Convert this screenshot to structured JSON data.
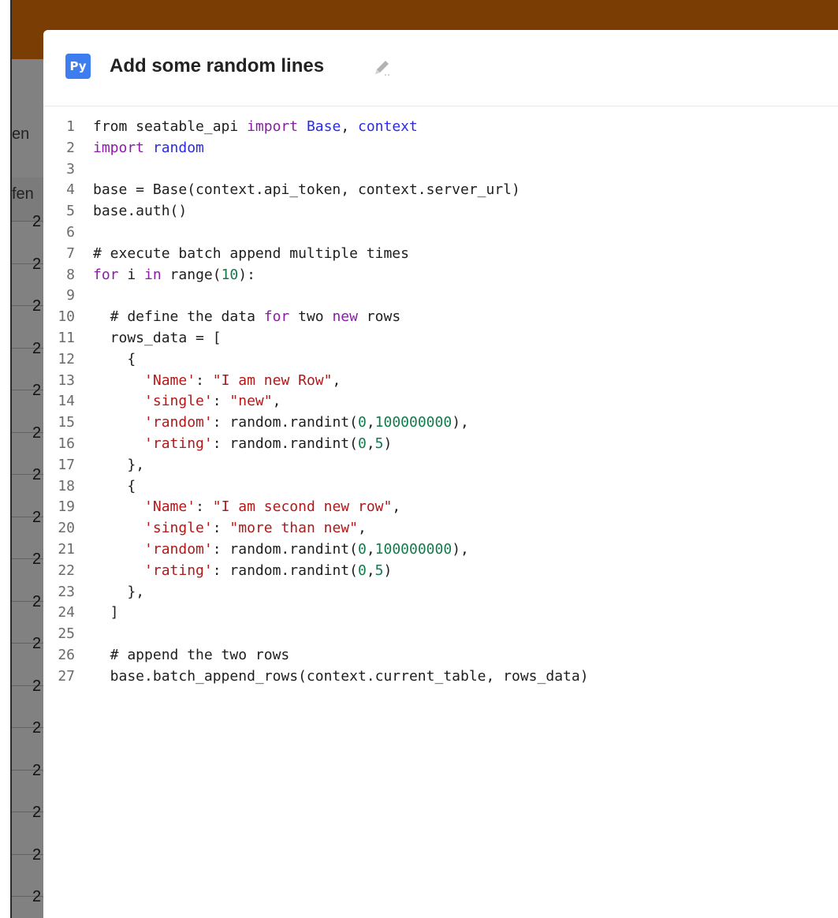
{
  "background": {
    "left_column_texts": [
      "en",
      "fen"
    ],
    "row_numbers": [
      "2",
      "2",
      "2",
      "2",
      "2",
      "2",
      "2",
      "2",
      "2",
      "2",
      "2",
      "2",
      "2",
      "2",
      "2",
      "2",
      "2"
    ]
  },
  "dialog": {
    "badge_label": "Py",
    "title": "Add some random lines",
    "edit_icon": "pencil-icon"
  },
  "code": {
    "lines": [
      {
        "n": "1",
        "tokens": [
          {
            "t": "from seatable_api ",
            "k": "plain"
          },
          {
            "t": "import",
            "k": "keyword"
          },
          {
            "t": " ",
            "k": "plain"
          },
          {
            "t": "Base",
            "k": "builtin"
          },
          {
            "t": ", ",
            "k": "plain"
          },
          {
            "t": "context",
            "k": "builtin"
          }
        ]
      },
      {
        "n": "2",
        "tokens": [
          {
            "t": "import",
            "k": "keyword"
          },
          {
            "t": " ",
            "k": "plain"
          },
          {
            "t": "random",
            "k": "builtin"
          }
        ]
      },
      {
        "n": "3",
        "tokens": []
      },
      {
        "n": "4",
        "tokens": [
          {
            "t": "base = Base(context.api_token, context.server_url)",
            "k": "plain"
          }
        ]
      },
      {
        "n": "5",
        "tokens": [
          {
            "t": "base.auth()",
            "k": "plain"
          }
        ]
      },
      {
        "n": "6",
        "tokens": []
      },
      {
        "n": "7",
        "tokens": [
          {
            "t": "# execute batch append multiple times",
            "k": "comment"
          }
        ]
      },
      {
        "n": "8",
        "tokens": [
          {
            "t": "for",
            "k": "keyword"
          },
          {
            "t": " i ",
            "k": "plain"
          },
          {
            "t": "in",
            "k": "keyword"
          },
          {
            "t": " range",
            "k": "plain"
          },
          {
            "t": "(",
            "k": "plain",
            "mark": true
          },
          {
            "t": "10",
            "k": "number"
          },
          {
            "t": "):",
            "k": "plain"
          }
        ]
      },
      {
        "n": "9",
        "tokens": []
      },
      {
        "n": "10",
        "tokens": [
          {
            "t": "  # define the data ",
            "k": "comment"
          },
          {
            "t": "for",
            "k": "keyword"
          },
          {
            "t": " two ",
            "k": "comment"
          },
          {
            "t": "new",
            "k": "keyword"
          },
          {
            "t": " rows",
            "k": "comment"
          }
        ]
      },
      {
        "n": "11",
        "tokens": [
          {
            "t": "  rows_data = [",
            "k": "plain"
          }
        ]
      },
      {
        "n": "12",
        "tokens": [
          {
            "t": "    {",
            "k": "plain"
          }
        ]
      },
      {
        "n": "13",
        "tokens": [
          {
            "t": "      ",
            "k": "plain"
          },
          {
            "t": "'Name'",
            "k": "string"
          },
          {
            "t": ": ",
            "k": "plain"
          },
          {
            "t": "\"",
            "k": "string",
            "mark": true
          },
          {
            "t": "I am new Row",
            "k": "string"
          },
          {
            "t": "\"",
            "k": "string",
            "mark": true
          },
          {
            "t": ",",
            "k": "plain"
          }
        ]
      },
      {
        "n": "14",
        "tokens": [
          {
            "t": "      ",
            "k": "plain"
          },
          {
            "t": "'single'",
            "k": "string"
          },
          {
            "t": ": ",
            "k": "plain"
          },
          {
            "t": "\"new\"",
            "k": "string",
            "mark": true
          },
          {
            "t": ",",
            "k": "plain"
          }
        ]
      },
      {
        "n": "15",
        "tokens": [
          {
            "t": "      ",
            "k": "plain"
          },
          {
            "t": "'random'",
            "k": "string"
          },
          {
            "t": ": random.randint(",
            "k": "plain"
          },
          {
            "t": "0",
            "k": "number"
          },
          {
            "t": ",",
            "k": "plain"
          },
          {
            "t": "100000000",
            "k": "number"
          },
          {
            "t": "),",
            "k": "plain"
          }
        ]
      },
      {
        "n": "16",
        "tokens": [
          {
            "t": "      ",
            "k": "plain"
          },
          {
            "t": "'rating'",
            "k": "string"
          },
          {
            "t": ": random.randint(",
            "k": "plain"
          },
          {
            "t": "0",
            "k": "number"
          },
          {
            "t": ",",
            "k": "plain"
          },
          {
            "t": "5",
            "k": "number"
          },
          {
            "t": ")",
            "k": "plain"
          }
        ]
      },
      {
        "n": "17",
        "tokens": [
          {
            "t": "   ",
            "k": "plain"
          },
          {
            "t": " }",
            "k": "plain",
            "mark": true
          },
          {
            "t": ",",
            "k": "plain"
          }
        ]
      },
      {
        "n": "18",
        "tokens": [
          {
            "t": "    {",
            "k": "plain"
          }
        ]
      },
      {
        "n": "19",
        "tokens": [
          {
            "t": "      ",
            "k": "plain"
          },
          {
            "t": "'Name'",
            "k": "string"
          },
          {
            "t": ": ",
            "k": "plain"
          },
          {
            "t": "\"",
            "k": "string",
            "mark": true
          },
          {
            "t": "I am second new row",
            "k": "string"
          },
          {
            "t": "\"",
            "k": "string",
            "mark": true
          },
          {
            "t": ",",
            "k": "plain"
          }
        ]
      },
      {
        "n": "20",
        "tokens": [
          {
            "t": "      ",
            "k": "plain"
          },
          {
            "t": "'single'",
            "k": "string"
          },
          {
            "t": ": ",
            "k": "plain"
          },
          {
            "t": "\"",
            "k": "string",
            "mark": true
          },
          {
            "t": "more than new",
            "k": "string"
          },
          {
            "t": "\"",
            "k": "string",
            "mark": true
          },
          {
            "t": ",",
            "k": "plain"
          }
        ]
      },
      {
        "n": "21",
        "tokens": [
          {
            "t": "      ",
            "k": "plain"
          },
          {
            "t": "'random'",
            "k": "string"
          },
          {
            "t": ": random.randint(",
            "k": "plain"
          },
          {
            "t": "0",
            "k": "number"
          },
          {
            "t": ",",
            "k": "plain"
          },
          {
            "t": "100000000",
            "k": "number"
          },
          {
            "t": "),",
            "k": "plain"
          }
        ]
      },
      {
        "n": "22",
        "tokens": [
          {
            "t": "      ",
            "k": "plain"
          },
          {
            "t": "'rating'",
            "k": "string"
          },
          {
            "t": ": random.randint(",
            "k": "plain"
          },
          {
            "t": "0",
            "k": "number"
          },
          {
            "t": ",",
            "k": "plain"
          },
          {
            "t": "5",
            "k": "number"
          },
          {
            "t": ")",
            "k": "plain"
          }
        ]
      },
      {
        "n": "23",
        "tokens": [
          {
            "t": "   ",
            "k": "plain"
          },
          {
            "t": " }",
            "k": "plain",
            "mark": true
          },
          {
            "t": ",",
            "k": "plain"
          }
        ]
      },
      {
        "n": "24",
        "tokens": [
          {
            "t": " ",
            "k": "plain"
          },
          {
            "t": " ]",
            "k": "plain",
            "mark": true
          }
        ]
      },
      {
        "n": "25",
        "tokens": []
      },
      {
        "n": "26",
        "tokens": [
          {
            "t": "  # append the two rows",
            "k": "comment"
          }
        ]
      },
      {
        "n": "27",
        "tokens": [
          {
            "t": "  base.batch_append_rows(context.current_table, rows_data)",
            "k": "plain"
          }
        ]
      }
    ]
  }
}
